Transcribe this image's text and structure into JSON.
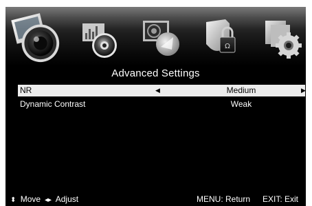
{
  "menu_bar": {
    "icons": [
      {
        "name": "picture-icon",
        "selected": true
      },
      {
        "name": "sound-icon",
        "selected": false
      },
      {
        "name": "channel-icon",
        "selected": false
      },
      {
        "name": "lock-icon",
        "selected": false
      },
      {
        "name": "setup-icon",
        "selected": false
      }
    ]
  },
  "title": "Advanced Settings",
  "settings": [
    {
      "label": "NR",
      "value": "Medium",
      "selected": true
    },
    {
      "label": "Dynamic Contrast",
      "value": "Weak",
      "selected": false
    }
  ],
  "footer": {
    "move_glyph": "⬍",
    "move_label": "Move",
    "adjust_glyph": "◂▸",
    "adjust_label": "Adjust",
    "menu_hint": "MENU: Return",
    "exit_hint": "EXIT: Exit"
  },
  "colors": {
    "background": "#000000",
    "selected_row": "#ececec",
    "text": "#ffffff"
  }
}
